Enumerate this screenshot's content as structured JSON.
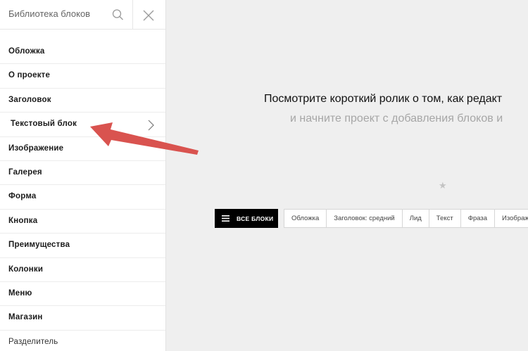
{
  "sidebar": {
    "search": {
      "placeholder": "Библиотека блоков"
    },
    "items": [
      {
        "label": "Обложка"
      },
      {
        "label": "О проекте"
      },
      {
        "label": "Заголовок"
      },
      {
        "label": "Текстовый блок"
      },
      {
        "label": "Изображение"
      },
      {
        "label": "Галерея"
      },
      {
        "label": "Форма"
      },
      {
        "label": "Кнопка"
      },
      {
        "label": "Преимущества"
      },
      {
        "label": "Колонки"
      },
      {
        "label": "Меню"
      },
      {
        "label": "Магазин"
      },
      {
        "label": "Разделитель"
      }
    ]
  },
  "main": {
    "headline": "Посмотрите короткий ролик о том, как редакт",
    "subline": "и начните проект с добавления блоков и",
    "all_blocks_label": "ВСЕ БЛОКИ",
    "tags": [
      "Обложка",
      "Заголовок: средний",
      "Лид",
      "Текст",
      "Фраза",
      "Изображе"
    ]
  },
  "colors": {
    "arrow": "#d9534f",
    "button": "#000000"
  }
}
